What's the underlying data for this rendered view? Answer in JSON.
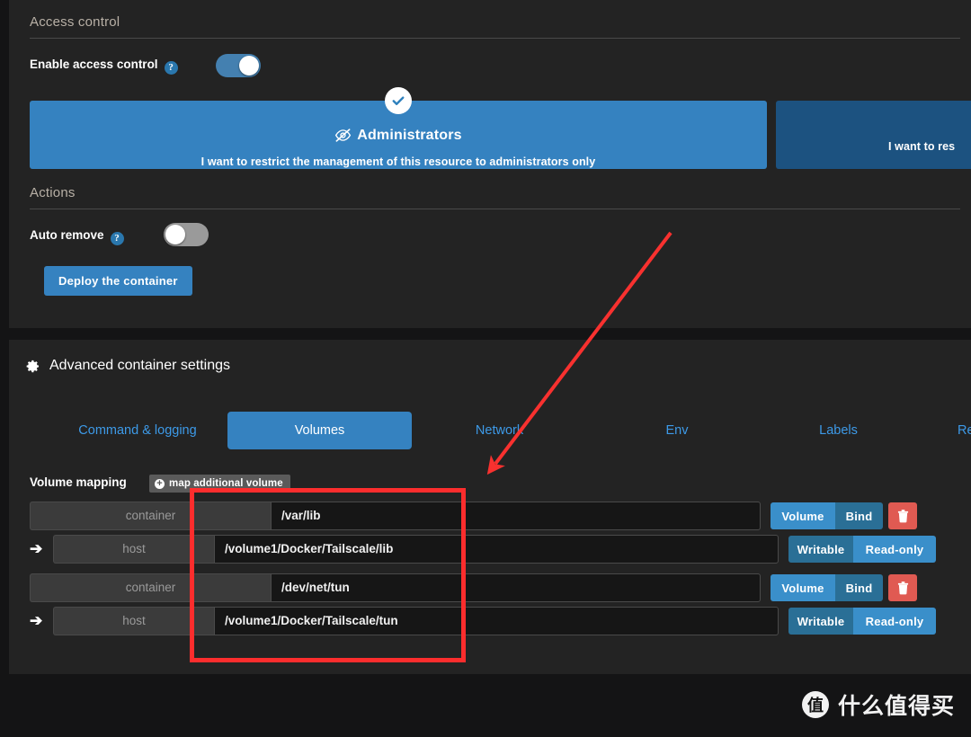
{
  "sections": {
    "access_control": {
      "title": "Access control",
      "enable_label": "Enable access control",
      "enable_help": "?",
      "enable_state": "on",
      "cards": [
        {
          "title": "Administrators",
          "subtitle": "I want to restrict the management of this resource to administrators only",
          "icon": "eye-slash-icon",
          "selected": true,
          "check": "✓"
        },
        {
          "title": "",
          "subtitle": "I want to res",
          "icon": "",
          "selected": false,
          "check": ""
        }
      ]
    },
    "actions": {
      "title": "Actions",
      "auto_remove_label": "Auto remove",
      "auto_remove_help": "?",
      "auto_remove_state": "off",
      "deploy_button": "Deploy the container"
    },
    "advanced": {
      "title": "Advanced container settings",
      "gear_icon": "gear-icon",
      "tabs": [
        {
          "label": "Command & logging",
          "active": false
        },
        {
          "label": "Volumes",
          "active": true
        },
        {
          "label": "Network",
          "active": false
        },
        {
          "label": "Env",
          "active": false
        },
        {
          "label": "Labels",
          "active": false
        },
        {
          "label": "Re",
          "active": false
        }
      ],
      "volume_mapping": {
        "label": "Volume mapping",
        "add_button": "map additional volume",
        "add_icon": "plus-circle-icon",
        "arrow_glyph": "➔",
        "trash_icon": "trash-icon",
        "rows": [
          {
            "container_addon": "container",
            "container_value": "/var/lib",
            "host_addon": "host",
            "host_value": "/volume1/Docker/Tailscale/lib",
            "type_options": [
              {
                "label": "Volume",
                "selected": true
              },
              {
                "label": "Bind",
                "selected": false
              }
            ],
            "access_options": [
              {
                "label": "Writable",
                "selected": false
              },
              {
                "label": "Read-only",
                "selected": true
              }
            ]
          },
          {
            "container_addon": "container",
            "container_value": "/dev/net/tun",
            "host_addon": "host",
            "host_value": "/volume1/Docker/Tailscale/tun",
            "type_options": [
              {
                "label": "Volume",
                "selected": true
              },
              {
                "label": "Bind",
                "selected": false
              }
            ],
            "access_options": [
              {
                "label": "Writable",
                "selected": false
              },
              {
                "label": "Read-only",
                "selected": true
              }
            ]
          }
        ]
      }
    }
  },
  "annotations": {
    "arrow_color": "#f8312f",
    "box_color": "#fc2d2d"
  },
  "watermark": {
    "logo_char": "值",
    "text": "什么值得买"
  },
  "colors": {
    "accent_blue": "#3582c0",
    "link_blue": "#3d9ae8",
    "panel_bg": "#232323",
    "page_bg": "#141415",
    "danger_red": "#e05a52",
    "seg_on": "#3a8fca",
    "seg_off": "#2a6f96"
  }
}
